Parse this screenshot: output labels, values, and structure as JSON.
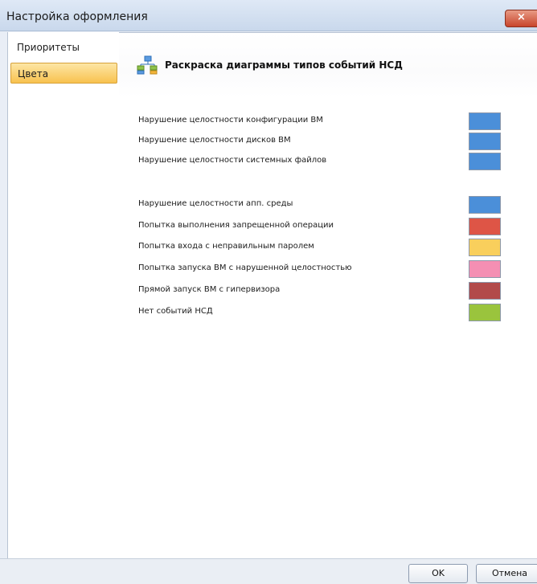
{
  "window": {
    "title": "Настройка оформления",
    "close_label": "×"
  },
  "sidebar": {
    "items": [
      {
        "label": "Приоритеты"
      },
      {
        "label": "Цвета"
      }
    ]
  },
  "main": {
    "header_icon": "network-diagram-icon",
    "header_title": "Раскраска диаграммы типов событий НСД",
    "colors": [
      {
        "label": "Нарушение целостности конфигурации ВМ",
        "color": "#4b8fd9"
      },
      {
        "label": "Нарушение целостности дисков ВМ",
        "color": "#4b8fd9"
      },
      {
        "label": "Нарушение целостности системных файлов",
        "color": "#4b8fd9"
      },
      {
        "label": "Нарушение целостности апп. среды",
        "color": "#4b8fd9"
      },
      {
        "label": "Попытка выполнения запрещенной операции",
        "color": "#de5546"
      },
      {
        "label": "Попытка входа с неправильным паролем",
        "color": "#f9cf5c"
      },
      {
        "label": "Попытка запуска ВМ с нарушенной целостностью",
        "color": "#f48fb3"
      },
      {
        "label": "Прямой запуск ВМ с гипервизора",
        "color": "#b24a4a"
      },
      {
        "label": "Нет событий НСД",
        "color": "#9ac43d"
      }
    ]
  },
  "footer": {
    "ok_label": "OK",
    "cancel_label": "Отмена"
  }
}
